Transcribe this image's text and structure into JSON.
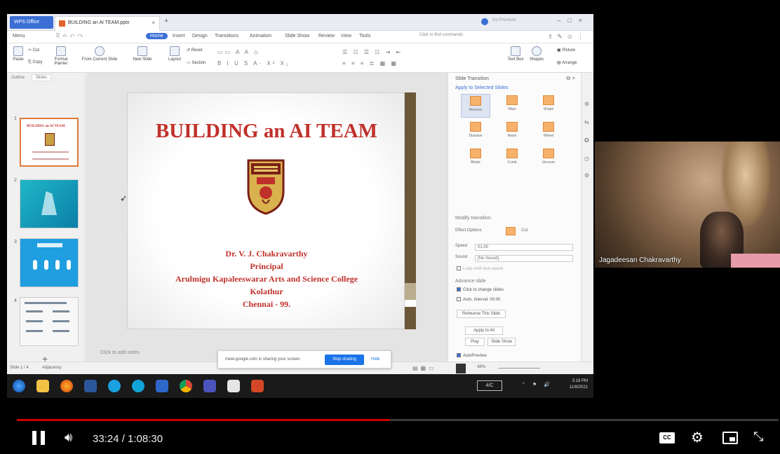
{
  "window": {
    "app_tab": "WPS Office",
    "doc_tab": "BUILDING an AI TEAM.pptx",
    "signin": "Go Premium"
  },
  "ribbon": {
    "tabs": [
      "Menu",
      "Home",
      "Insert",
      "Design",
      "Transitions",
      "Animation",
      "Slide Show",
      "Review",
      "View",
      "Tools"
    ],
    "search_placeholder": "Click to find commands",
    "buttons": {
      "paste": "Paste",
      "cut": "Cut",
      "copy": "Copy",
      "format_painter": "Format Painter",
      "play": "From Current Slide",
      "new_slide": "New Slide",
      "layout": "Layout",
      "reset": "Reset",
      "section": "Section",
      "text_box": "Text Box",
      "shapes": "Shapes",
      "arrange": "Arrange",
      "picture": "Picture"
    }
  },
  "slides_panel": {
    "tabs": [
      "Outline",
      "Slides"
    ],
    "numbers": [
      "1",
      "2",
      "3",
      "4"
    ],
    "thumb1_title": "BUILDING an AI TEAM",
    "notes_placeholder": "Click to add notes"
  },
  "slide": {
    "title": "BUILDING an AI TEAM",
    "name": "Dr. V. J. Chakravarthy",
    "role": "Principal",
    "college": "Arulmigu Kapaleeswarar Arts and Science College",
    "place": "Kolathur",
    "city": "Chennai - 99."
  },
  "transition_panel": {
    "title": "Slide Transition",
    "apply_label": "Apply to Selected Slides",
    "effects": [
      "Remove",
      "Wipe",
      "Shape",
      "Dissolve",
      "News",
      "Wheel",
      "Blinds",
      "Comb",
      "Uncover"
    ],
    "modify_label": "Modify transition",
    "effect_options_label": "Effect Options",
    "effect_value": "Cut",
    "speed_label": "Speed",
    "speed_value": "01.00",
    "sound_label": "Sound",
    "sound_value": "[No Sound]",
    "loop_label": "Loop until next sound",
    "advance_label": "Advance slide",
    "on_click_label": "Click to change slides",
    "auto_label": "Auto. interval:",
    "auto_value": "00:00",
    "rehearse_label": "Rehearse This Slide",
    "apply_all_label": "Apply to All",
    "play_label": "Play",
    "slideshow_label": "Slide Show",
    "autopreview_label": "AutoPreview"
  },
  "status_bar": {
    "slide_count": "Slide 1 / 4",
    "theme": "Adjacency",
    "zoom": "48%"
  },
  "share_banner": {
    "text": "meet.google.com is sharing your screen.",
    "stop_label": "Stop sharing",
    "hide_label": "Hide"
  },
  "taskbar": {
    "lang": "4/C",
    "time": "3:18 PM",
    "date": "11/8/2021"
  },
  "webcam": {
    "name": "Jagadeesan Chakravarthy"
  },
  "player": {
    "time": "33:24 / 1:08:30",
    "progress": 0.49,
    "cc_label": "CC"
  },
  "colors": {
    "slide_red": "#c0302a",
    "accent_blue": "#3b6fd6",
    "progress_red": "#cc0000"
  }
}
